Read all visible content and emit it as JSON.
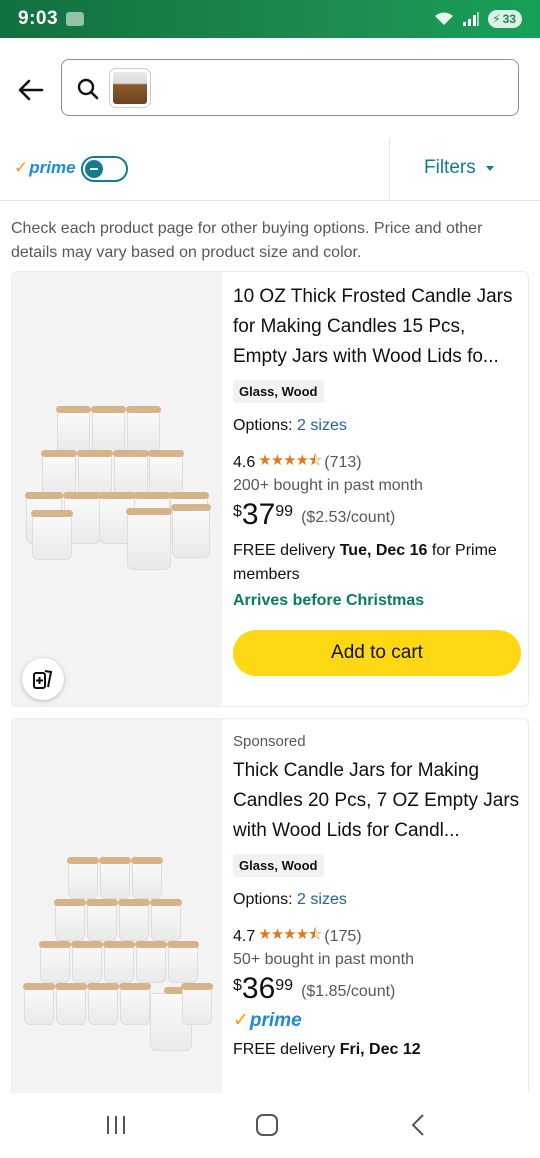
{
  "status_bar": {
    "time": "9:03",
    "battery": "33"
  },
  "search": {
    "placeholder": ""
  },
  "filter_bar": {
    "prime_label": "prime",
    "filters_label": "Filters"
  },
  "disclaimer": "Check each product page for other buying options. Price and other details may vary based on product size and color.",
  "products": [
    {
      "title": "10 OZ Thick Frosted Candle Jars for Making Candles 15 Pcs, Empty Jars with Wood Lids fo...",
      "material": "Glass, Wood",
      "options_label": "Options:",
      "options_link": "2 sizes",
      "rating": "4.6",
      "stars": "★★★★⯪",
      "reviews": "(713)",
      "bought": "200+ bought in past month",
      "price_symbol": "$",
      "price_whole": "37",
      "price_fraction": "99",
      "unit_price": "($2.53/count)",
      "delivery_prefix": "FREE delivery",
      "delivery_date": "Tue, Dec 16",
      "delivery_suffix": "for Prime members",
      "arrives": "Arrives before Christmas",
      "add_to_cart": "Add to cart"
    },
    {
      "sponsored": "Sponsored",
      "title": "Thick Candle Jars for Making Candles 20 Pcs, 7 OZ Empty Jars with Wood Lids for Candl...",
      "material": "Glass, Wood",
      "options_label": "Options:",
      "options_link": "2 sizes",
      "rating": "4.7",
      "stars": "★★★★⯪",
      "reviews": "(175)",
      "bought": "50+ bought in past month",
      "price_symbol": "$",
      "price_whole": "36",
      "price_fraction": "99",
      "unit_price": "($1.85/count)",
      "prime_badge": "prime",
      "delivery_prefix": "FREE delivery",
      "delivery_date": "Fri, Dec 12"
    }
  ],
  "colors": {
    "accent": "#147c8f",
    "prime": "#1a8cd8",
    "add_button": "#ffd814",
    "arrives": "#067d62",
    "link": "#2162a1"
  }
}
